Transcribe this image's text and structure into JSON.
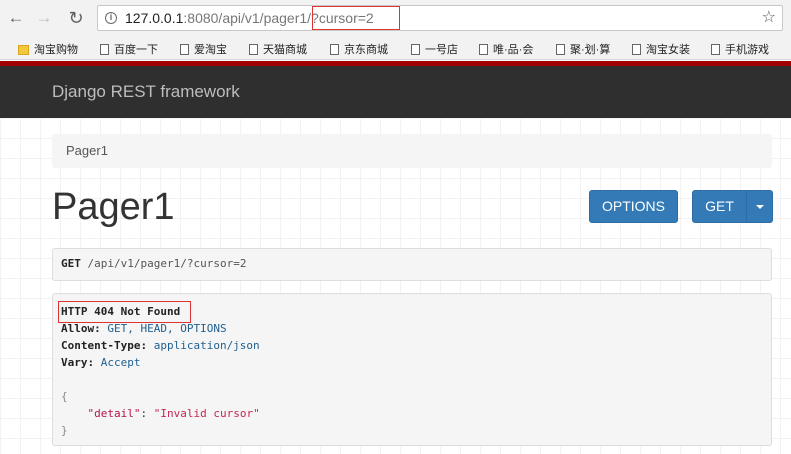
{
  "browser": {
    "back_glyph": "←",
    "forward_glyph": "→",
    "reload_glyph": "↻",
    "lock_glyph": "i",
    "url_host": "127.0.0.1",
    "url_rest": ":8080/api/v1/pager1/",
    "url_query": "?cursor=2",
    "star_glyph": "☆"
  },
  "bookmarks": [
    {
      "label": "淘宝购物",
      "icon": "folder-icon"
    },
    {
      "label": "百度一下",
      "icon": "page-icon"
    },
    {
      "label": "爱淘宝",
      "icon": "page-icon"
    },
    {
      "label": "天猫商城",
      "icon": "page-icon"
    },
    {
      "label": "京东商城",
      "icon": "page-icon"
    },
    {
      "label": "一号店",
      "icon": "page-icon"
    },
    {
      "label": "唯·品·会",
      "icon": "page-icon"
    },
    {
      "label": "聚·划·算",
      "icon": "page-icon"
    },
    {
      "label": "淘宝女装",
      "icon": "page-icon"
    },
    {
      "label": "手机游戏",
      "icon": "page-icon"
    }
  ],
  "navbar": {
    "brand": "Django REST framework"
  },
  "breadcrumb": "Pager1",
  "page_title": "Pager1",
  "buttons": {
    "options": "OPTIONS",
    "get": "GET"
  },
  "request": {
    "method": "GET",
    "path": " /api/v1/pager1/",
    "query": "?cursor=2"
  },
  "response": {
    "status": "HTTP 404 Not Found",
    "headers": [
      {
        "name": "Allow:",
        "value": " GET, HEAD, OPTIONS"
      },
      {
        "name": "Content-Type:",
        "value": " application/json"
      },
      {
        "name": "Vary:",
        "value": " Accept"
      }
    ],
    "open_brace": "{",
    "body_key": "\"detail\"",
    "body_sep": ": ",
    "body_value": "\"Invalid cursor\"",
    "close_brace": "}"
  },
  "colors": {
    "accent": "#337ab7",
    "navbar": "#2f2f2f",
    "brand_line": "#a30000",
    "highlight_box": "#dd3333"
  }
}
